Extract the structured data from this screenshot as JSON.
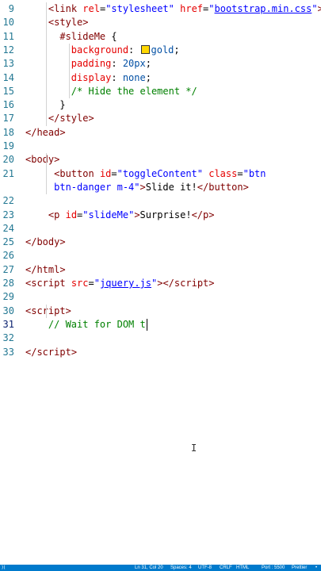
{
  "editor": {
    "lines": [
      {
        "n": "9",
        "tokens": [
          [
            "    ",
            "txt"
          ],
          [
            "<",
            "punct"
          ],
          [
            "link ",
            "tag"
          ],
          [
            "rel",
            "attr"
          ],
          [
            "=",
            "txt"
          ],
          [
            "\"stylesheet\"",
            "str"
          ],
          [
            " ",
            "txt"
          ],
          [
            "href",
            "attr"
          ],
          [
            "=",
            "txt"
          ],
          [
            "\"",
            "str"
          ],
          [
            "bootstrap.min.css",
            "link"
          ],
          [
            "\"",
            "str"
          ],
          [
            ">",
            "punct"
          ]
        ]
      },
      {
        "n": "10",
        "tokens": [
          [
            "    ",
            "txt"
          ],
          [
            "<",
            "punct"
          ],
          [
            "style",
            "tag"
          ],
          [
            ">",
            "punct"
          ]
        ]
      },
      {
        "n": "11",
        "tokens": [
          [
            "      ",
            "txt"
          ],
          [
            "#slideMe",
            "sel"
          ],
          [
            " {",
            "txt"
          ]
        ]
      },
      {
        "n": "12",
        "tokens": [
          [
            "        ",
            "txt"
          ],
          [
            "background",
            "prop"
          ],
          [
            ": ",
            "txt"
          ],
          [
            "__swatch__",
            "swatch"
          ],
          [
            "gold",
            "val"
          ],
          [
            ";",
            "txt"
          ]
        ]
      },
      {
        "n": "13",
        "tokens": [
          [
            "        ",
            "txt"
          ],
          [
            "padding",
            "prop"
          ],
          [
            ": ",
            "txt"
          ],
          [
            "20px",
            "val"
          ],
          [
            ";",
            "txt"
          ]
        ]
      },
      {
        "n": "14",
        "tokens": [
          [
            "        ",
            "txt"
          ],
          [
            "display",
            "prop"
          ],
          [
            ": ",
            "txt"
          ],
          [
            "none",
            "val"
          ],
          [
            ";",
            "txt"
          ]
        ]
      },
      {
        "n": "15",
        "tokens": [
          [
            "        ",
            "txt"
          ],
          [
            "/* Hide the element */",
            "com"
          ]
        ]
      },
      {
        "n": "16",
        "tokens": [
          [
            "      ",
            "txt"
          ],
          [
            "}",
            "txt"
          ]
        ]
      },
      {
        "n": "17",
        "tokens": [
          [
            "    ",
            "txt"
          ],
          [
            "</",
            "punct"
          ],
          [
            "style",
            "tag"
          ],
          [
            ">",
            "punct"
          ]
        ]
      },
      {
        "n": "18",
        "tokens": [
          [
            "</",
            "punct"
          ],
          [
            "head",
            "tag"
          ],
          [
            ">",
            "punct"
          ]
        ]
      },
      {
        "n": "19",
        "tokens": []
      },
      {
        "n": "20",
        "tokens": [
          [
            "<",
            "punct"
          ],
          [
            "body",
            "tag"
          ],
          [
            ">",
            "punct"
          ]
        ]
      },
      {
        "n": "21",
        "tokens": [
          [
            "     ",
            "txt"
          ],
          [
            "<",
            "punct"
          ],
          [
            "button ",
            "tag"
          ],
          [
            "id",
            "attr"
          ],
          [
            "=",
            "txt"
          ],
          [
            "\"toggleContent\"",
            "str"
          ],
          [
            " ",
            "txt"
          ],
          [
            "class",
            "attr"
          ],
          [
            "=",
            "txt"
          ],
          [
            "\"btn",
            "str"
          ]
        ]
      },
      {
        "n": "",
        "tokens": [
          [
            "     ",
            "txt"
          ],
          [
            "btn-danger m-4\"",
            "str"
          ],
          [
            ">",
            "punct"
          ],
          [
            "Slide it!",
            "txt"
          ],
          [
            "</",
            "punct"
          ],
          [
            "button",
            "tag"
          ],
          [
            ">",
            "punct"
          ]
        ]
      },
      {
        "n": "22",
        "tokens": []
      },
      {
        "n": "23",
        "tokens": [
          [
            "    ",
            "txt"
          ],
          [
            "<",
            "punct"
          ],
          [
            "p ",
            "tag"
          ],
          [
            "id",
            "attr"
          ],
          [
            "=",
            "txt"
          ],
          [
            "\"slideMe\"",
            "str"
          ],
          [
            ">",
            "punct"
          ],
          [
            "Surprise!",
            "txt"
          ],
          [
            "</",
            "punct"
          ],
          [
            "p",
            "tag"
          ],
          [
            ">",
            "punct"
          ]
        ]
      },
      {
        "n": "24",
        "tokens": []
      },
      {
        "n": "25",
        "tokens": [
          [
            "</",
            "punct"
          ],
          [
            "body",
            "tag"
          ],
          [
            ">",
            "punct"
          ]
        ]
      },
      {
        "n": "26",
        "tokens": []
      },
      {
        "n": "27",
        "tokens": [
          [
            "</",
            "punct"
          ],
          [
            "html",
            "tag"
          ],
          [
            ">",
            "punct"
          ]
        ]
      },
      {
        "n": "28",
        "tokens": [
          [
            "<",
            "punct"
          ],
          [
            "script ",
            "tag"
          ],
          [
            "src",
            "attr"
          ],
          [
            "=",
            "txt"
          ],
          [
            "\"",
            "str"
          ],
          [
            "jquery.js",
            "link"
          ],
          [
            "\"",
            "str"
          ],
          [
            "></",
            "punct"
          ],
          [
            "script",
            "tag"
          ],
          [
            ">",
            "punct"
          ]
        ]
      },
      {
        "n": "29",
        "tokens": []
      },
      {
        "n": "30",
        "tokens": [
          [
            "<",
            "punct"
          ],
          [
            "script",
            "tag"
          ],
          [
            ">",
            "punct"
          ]
        ]
      },
      {
        "n": "31",
        "tokens": [
          [
            "    ",
            "txt"
          ],
          [
            "// Wait for DOM t",
            "com"
          ]
        ]
      },
      {
        "n": "32",
        "tokens": []
      },
      {
        "n": "33",
        "tokens": [
          [
            "</",
            "punct"
          ],
          [
            "script",
            "tag"
          ],
          [
            ">",
            "punct"
          ]
        ]
      }
    ],
    "active_line": "31"
  },
  "status_bar": {
    "items": [
      "Ln 31, Col 20",
      "Spaces: 4",
      "UTF-8",
      "CRLF",
      "HTML",
      "Port : 5500",
      "Prettier"
    ]
  },
  "colors": {
    "status_bar_bg": "#007acc",
    "line_number": "#237893",
    "tag": "#800000",
    "attribute": "#e50000",
    "string": "#0000ff",
    "css_value": "#0451a5",
    "comment": "#008000",
    "swatch_gold": "#ffd700"
  },
  "icons": [
    "text-cursor-ibeam-icon",
    "remote-icon",
    "bell-icon"
  ]
}
